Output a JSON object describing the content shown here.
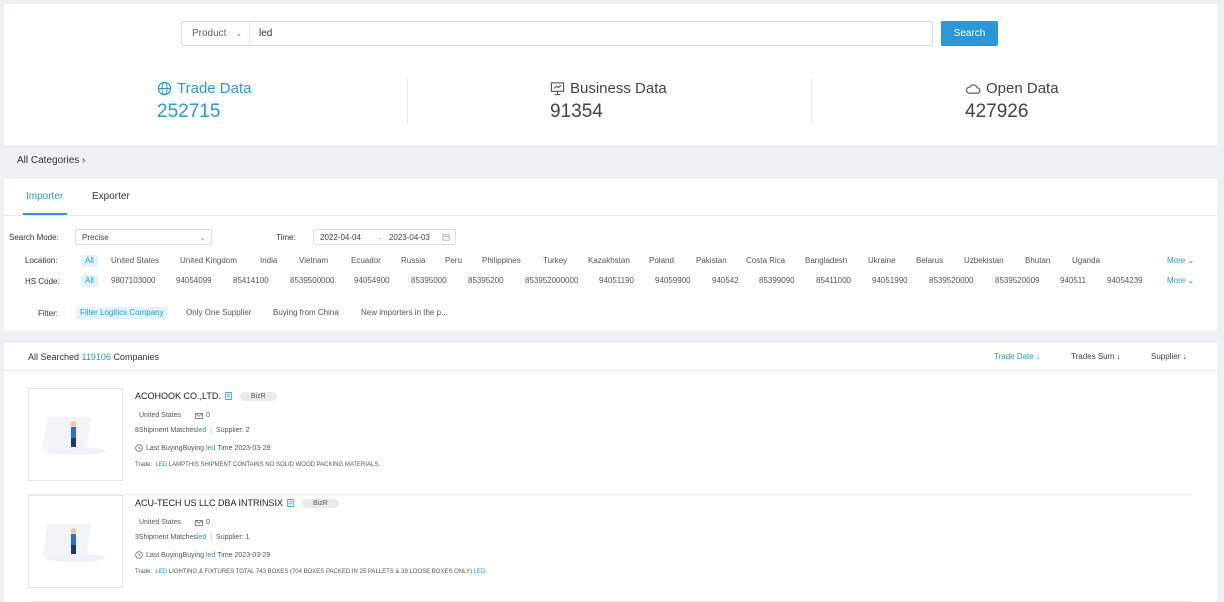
{
  "search": {
    "type_label": "Product",
    "query": "led",
    "button_label": "Search"
  },
  "stats": [
    {
      "title": "Trade Data",
      "value": "252715",
      "icon": "globe-icon"
    },
    {
      "title": "Business Data",
      "value": "91354",
      "icon": "presentation-icon"
    },
    {
      "title": "Open Data",
      "value": "427926",
      "icon": "cloud-icon"
    }
  ],
  "categories": {
    "label": "All Categories"
  },
  "tabs": [
    "Importer",
    "Exporter"
  ],
  "filters": {
    "search_mode_label": "Search Mode:",
    "search_mode_value": "Precise",
    "time_label": "Time:",
    "time_start": "2022-04-04",
    "time_end": "2023-04-03",
    "location_label": "Location:",
    "locations": [
      "All",
      "United States",
      "United Kingdom",
      "India",
      "Vietnam",
      "Ecuador",
      "Russia",
      "Peru",
      "Philippines",
      "Turkey",
      "Kazakhstan",
      "Poland",
      "Pakistan",
      "Costa Rica",
      "Bangladesh",
      "Ukraine",
      "Belarus",
      "Uzbekistan",
      "Bhutan",
      "Uganda"
    ],
    "hs_label": "HS Code:",
    "hs_codes": [
      "All",
      "9807103000",
      "94054099",
      "85414100",
      "8539500000",
      "94054900",
      "85395000",
      "85395200",
      "853952000000",
      "94051190",
      "94059900",
      "940542",
      "85399090",
      "85411000",
      "94051990",
      "8539520000",
      "8539520009",
      "940511",
      "94054239"
    ],
    "more_label": "More",
    "filter_label": "Filter:",
    "filter_options": [
      "Filter Logitics Company",
      "Only One Supplier",
      "Buying from China",
      "New importers in the p..."
    ]
  },
  "results": {
    "prefix": "All Searched",
    "count": "119106",
    "suffix": "Companies",
    "sorts": [
      "Trade Date",
      "Trades Sum",
      "Supplier"
    ],
    "items": [
      {
        "name": "ACOHOOK CO.,LTD.",
        "badge": "BizR",
        "country": "United States",
        "mail_count": "0",
        "shipments_prefix": "8Shipment Matches",
        "shipments_kw": "led",
        "supplier": "Supplier:  2",
        "last_prefix": "Last BuyingBuying",
        "last_kw": "led",
        "last_suffix": "Time 2023-03-29",
        "trade_label": "Trade:",
        "trade_kw": "LED",
        "trade_text": "LAMPTHIS SHIPMENT CONTAINS NO SOLID WOOD PACKING MATERIALS.",
        "trade_kw2": ""
      },
      {
        "name": "ACU-TECH US LLC DBA INTRINSIX",
        "badge": "BizR",
        "country": "United States",
        "mail_count": "0",
        "shipments_prefix": "3Shipment Matches",
        "shipments_kw": "led",
        "supplier": "Supplier:  1",
        "last_prefix": "Last BuyingBuying",
        "last_kw": "led",
        "last_suffix": "Time 2023-03-29",
        "trade_label": "Trade:",
        "trade_kw": "LED",
        "trade_text": "LIGHTING & FIXTURES TOTAL 743 BOXES (704 BOXES PACKED IN 25 PALLETS & 39 LOOSE BOXES ONLY)",
        "trade_kw2": "LED"
      }
    ]
  },
  "colors": {
    "accent": "#2a98d6",
    "background": "#eef0f4"
  }
}
